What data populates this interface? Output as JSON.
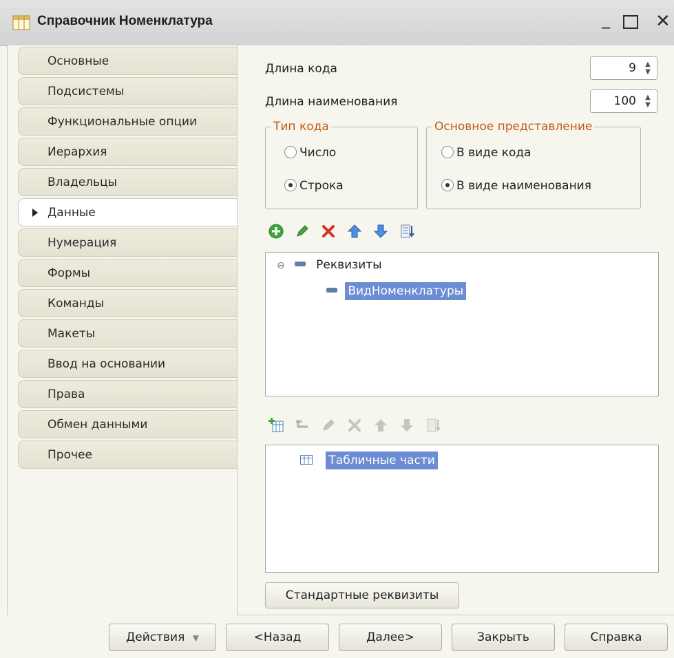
{
  "window": {
    "title": "Справочник Номенклатура"
  },
  "tabs": [
    {
      "label": "Основные",
      "active": false
    },
    {
      "label": "Подсистемы",
      "active": false
    },
    {
      "label": "Функциональные опции",
      "active": false
    },
    {
      "label": "Иерархия",
      "active": false
    },
    {
      "label": "Владельцы",
      "active": false
    },
    {
      "label": "Данные",
      "active": true
    },
    {
      "label": "Нумерация",
      "active": false
    },
    {
      "label": "Формы",
      "active": false
    },
    {
      "label": "Команды",
      "active": false
    },
    {
      "label": "Макеты",
      "active": false
    },
    {
      "label": "Ввод на основании",
      "active": false
    },
    {
      "label": "Права",
      "active": false
    },
    {
      "label": "Обмен данными",
      "active": false
    },
    {
      "label": "Прочее",
      "active": false
    }
  ],
  "content": {
    "code_length_label": "Длина кода",
    "code_length_value": "9",
    "name_length_label": "Длина наименования",
    "name_length_value": "100",
    "code_type": {
      "legend": "Тип кода",
      "options": [
        {
          "label": "Число",
          "selected": false
        },
        {
          "label": "Строка",
          "selected": true
        }
      ]
    },
    "main_presentation": {
      "legend": "Основное представление",
      "options": [
        {
          "label": "В виде кода",
          "selected": false
        },
        {
          "label": "В виде наименования",
          "selected": true
        }
      ]
    },
    "attributes_tree": {
      "root": "Реквизиты",
      "items": [
        "ВидНоменклатуры"
      ]
    },
    "tabular_tree": {
      "root": "Табличные части"
    },
    "standard_attributes_button": "Стандартные реквизиты"
  },
  "icons": {
    "toolbar1": [
      "add-icon",
      "edit-icon",
      "delete-icon",
      "move-up-icon",
      "move-down-icon",
      "sort-list-icon"
    ],
    "toolbar2": [
      "add-table-icon",
      "add-child-icon",
      "edit-icon",
      "delete-icon",
      "move-up-icon",
      "move-down-icon",
      "sort-list-icon"
    ]
  },
  "footer": {
    "actions": "Действия",
    "back": "<Назад",
    "next": "Далее>",
    "close": "Закрыть",
    "help": "Справка"
  }
}
